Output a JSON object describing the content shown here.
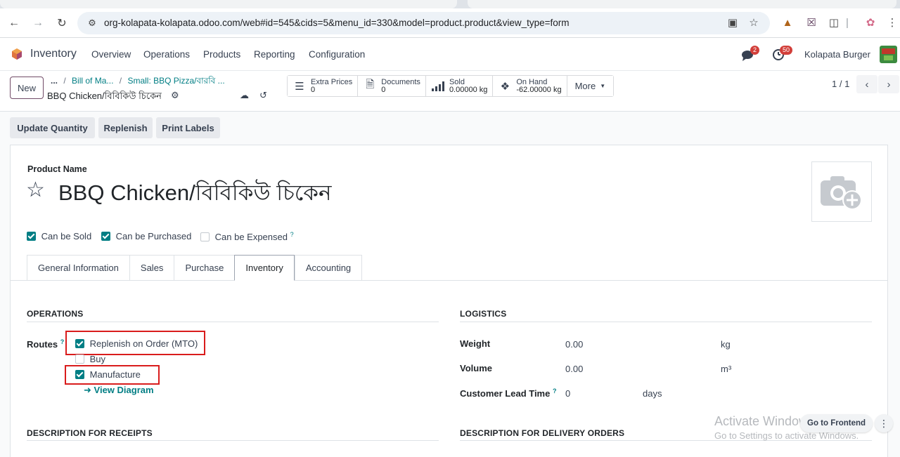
{
  "browser": {
    "url": "org-kolapata-kolapata.odoo.com/web#id=545&cids=5&menu_id=330&model=product.product&view_type=form"
  },
  "navbar": {
    "app_name": "Inventory",
    "menus": [
      "Overview",
      "Operations",
      "Products",
      "Reporting",
      "Configuration"
    ],
    "messages_count": "2",
    "activities_count": "50",
    "company": "Kolapata Burger"
  },
  "control_panel": {
    "new_label": "New",
    "breadcrumb": {
      "ellipsis": "...",
      "item1": "Bill of Ma...",
      "item2": "Small: BBQ Pizza/বারবি ...",
      "current": "BBQ Chicken/বিবিকিউ চিকেন"
    },
    "smart_buttons": [
      {
        "label": "Extra Prices",
        "value": "0",
        "icon": "list-icon"
      },
      {
        "label": "Documents",
        "value": "0",
        "icon": "document-icon"
      },
      {
        "label": "Sold",
        "value": "0.00000 kg",
        "icon": "bar-chart-icon"
      },
      {
        "label": "On Hand",
        "value": "-62.00000 kg",
        "icon": "cubes-icon"
      }
    ],
    "more_label": "More",
    "pager": "1 / 1"
  },
  "actions": {
    "update_quantity": "Update Quantity",
    "replenish": "Replenish",
    "print_labels": "Print Labels"
  },
  "form": {
    "product_name_label": "Product Name",
    "product_name": "BBQ Chicken/বিবিকিউ চিকেন",
    "can_be_sold": "Can be Sold",
    "can_be_purchased": "Can be Purchased",
    "can_be_expensed": "Can be Expensed",
    "help_mark": "?",
    "tabs": [
      "General Information",
      "Sales",
      "Purchase",
      "Inventory",
      "Accounting"
    ],
    "active_tab": "Inventory",
    "operations": {
      "title": "OPERATIONS",
      "routes_label": "Routes",
      "routes": [
        {
          "label": "Replenish on Order (MTO)",
          "checked": true
        },
        {
          "label": "Buy",
          "checked": false
        },
        {
          "label": "Manufacture",
          "checked": true
        }
      ],
      "view_diagram": "View Diagram"
    },
    "logistics": {
      "title": "LOGISTICS",
      "weight_label": "Weight",
      "weight_value": "0.00",
      "weight_unit": "kg",
      "volume_label": "Volume",
      "volume_value": "0.00",
      "volume_unit": "m³",
      "lead_time_label": "Customer Lead Time",
      "lead_time_value": "0",
      "lead_time_unit": "days"
    },
    "desc_receipts": "DESCRIPTION FOR RECEIPTS",
    "desc_delivery": "DESCRIPTION FOR DELIVERY ORDERS"
  },
  "overlay": {
    "watermark_line1": "Activate Windows",
    "watermark_line2": "Go to Settings to activate Windows.",
    "go_frontend": "Go to Frontend"
  },
  "colors": {
    "teal": "#017e84",
    "brand": "#714b67",
    "highlight_red": "#d91c1c"
  }
}
